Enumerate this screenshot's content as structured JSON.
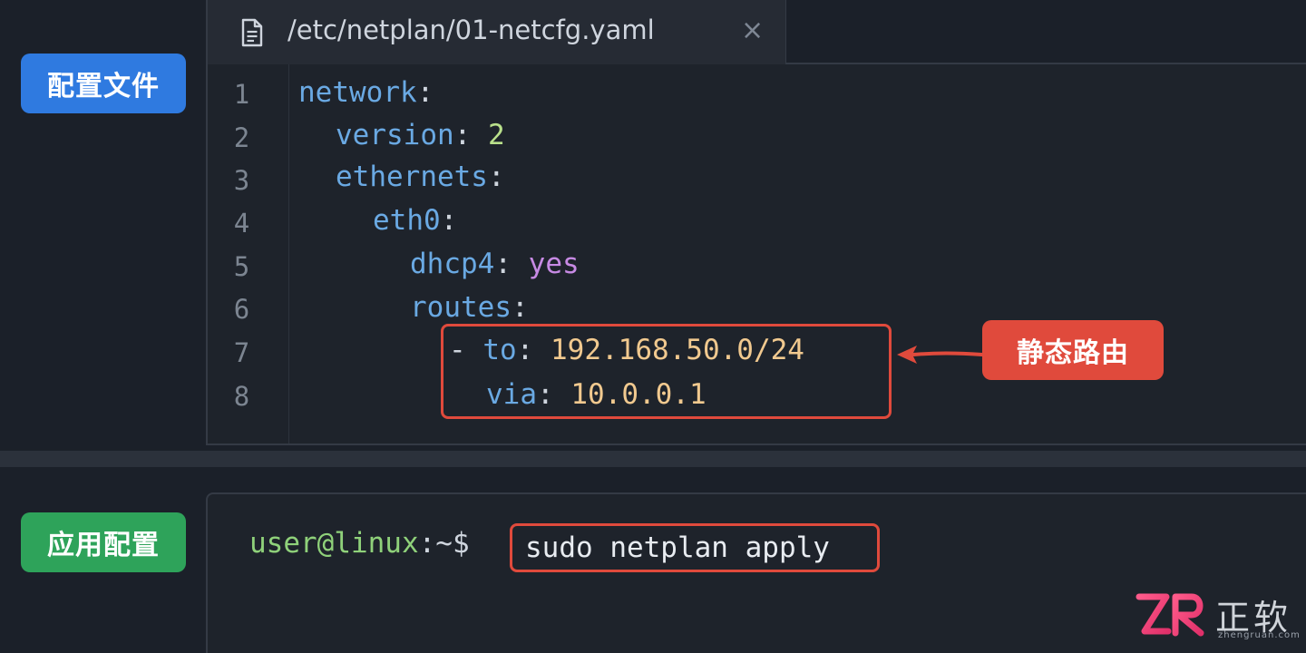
{
  "labels": {
    "config_file": "配置文件",
    "apply_config": "应用配置",
    "static_route": "静态路由"
  },
  "editor": {
    "tab_title": "/etc/netplan/01-netcfg.yaml",
    "close_symbol": "×",
    "line_numbers": [
      "1",
      "2",
      "3",
      "4",
      "5",
      "6",
      "7",
      "8"
    ],
    "lines": {
      "l1_key": "network",
      "l2_key": "version",
      "l2_val": "2",
      "l3_key": "ethernets",
      "l4_key": "eth0",
      "l5_key": "dhcp4",
      "l5_val": "yes",
      "l6_key": "routes",
      "l7_dash": "-",
      "l7_key": "to",
      "l7_val": "192.168.50.0/24",
      "l8_key": "via",
      "l8_val": "10.0.0.1"
    }
  },
  "terminal": {
    "prompt_user": "user@linux",
    "prompt_suffix": ":~$",
    "command": "sudo netplan apply"
  },
  "watermark": {
    "brand_cn": "正软",
    "domain": "zhengruan.com"
  },
  "colors": {
    "badge_blue": "#2f7ae0",
    "badge_green": "#2ea35a",
    "highlight_red": "#e04a3c",
    "key_blue": "#6aa9e3",
    "number_green": "#b9e08b",
    "bool_purple": "#c78ae4",
    "string_orange": "#f1c98f"
  },
  "icons": {
    "tab_icon": "file-icon",
    "close_icon": "close-icon",
    "arrow_icon": "arrow-left-icon",
    "logo": "zr-logo"
  }
}
